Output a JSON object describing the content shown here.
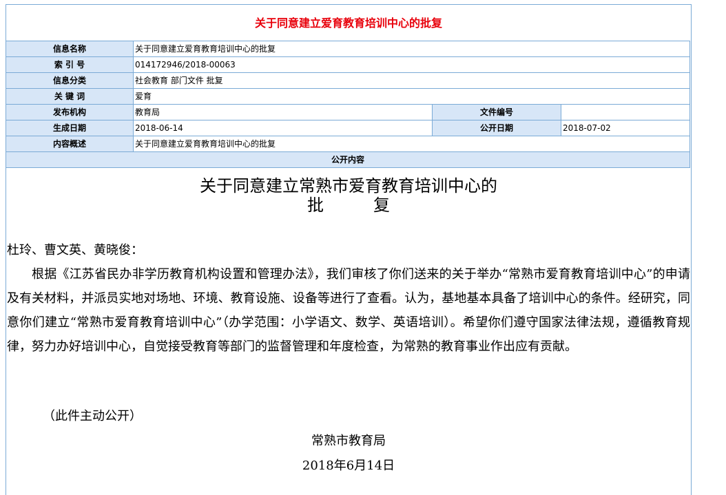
{
  "title": "关于同意建立爱育教育培训中心的批复",
  "info": {
    "name_label": "信息名称",
    "name_value": "关于同意建立爱育教育培训中心的批复",
    "index_label": "索 引 号",
    "index_value": "014172946/2018-00063",
    "category_label": "信息分类",
    "category_value": "社会教育 部门文件 批复",
    "keyword_label": "关 键 词",
    "keyword_value": "爱育",
    "publisher_label": "发布机构",
    "publisher_value": "教育局",
    "docno_label": "文件编号",
    "docno_value": "",
    "created_label": "生成日期",
    "created_value": "2018-06-14",
    "public_date_label": "公开日期",
    "public_date_value": "2018-07-02",
    "summary_label": "内容概述",
    "summary_value": "关于同意建立爱育教育培训中心的批复",
    "section_label": "公开内容"
  },
  "document": {
    "heading_line1": "关于同意建立常熟市爱育教育培训中心的",
    "heading_line2": "批　　　复",
    "salutation": "杜玲、曹文英、黄晓俊：",
    "paragraph": "根据《江苏省民办非学历教育机构设置和管理办法》，我们审核了你们送来的关于举办“常熟市爱育教育培训中心”的申请及有关材料，并派员实地对场地、环境、教育设施、设备等进行了查看。认为，基地基本具备了培训中心的条件。经研究，同意你们建立“常熟市爱育教育培训中心”（办学范围：小学语文、数学、英语培训）。希望你们遵守国家法律法规，遵循教育规律，努力办好培训中心，自觉接受教育等部门的监督管理和年度检查，为常熟的教育事业作出应有贡献。",
    "note": "（此件主动公开）",
    "signature": "常熟市教育局",
    "date": "2018年6月14日"
  }
}
